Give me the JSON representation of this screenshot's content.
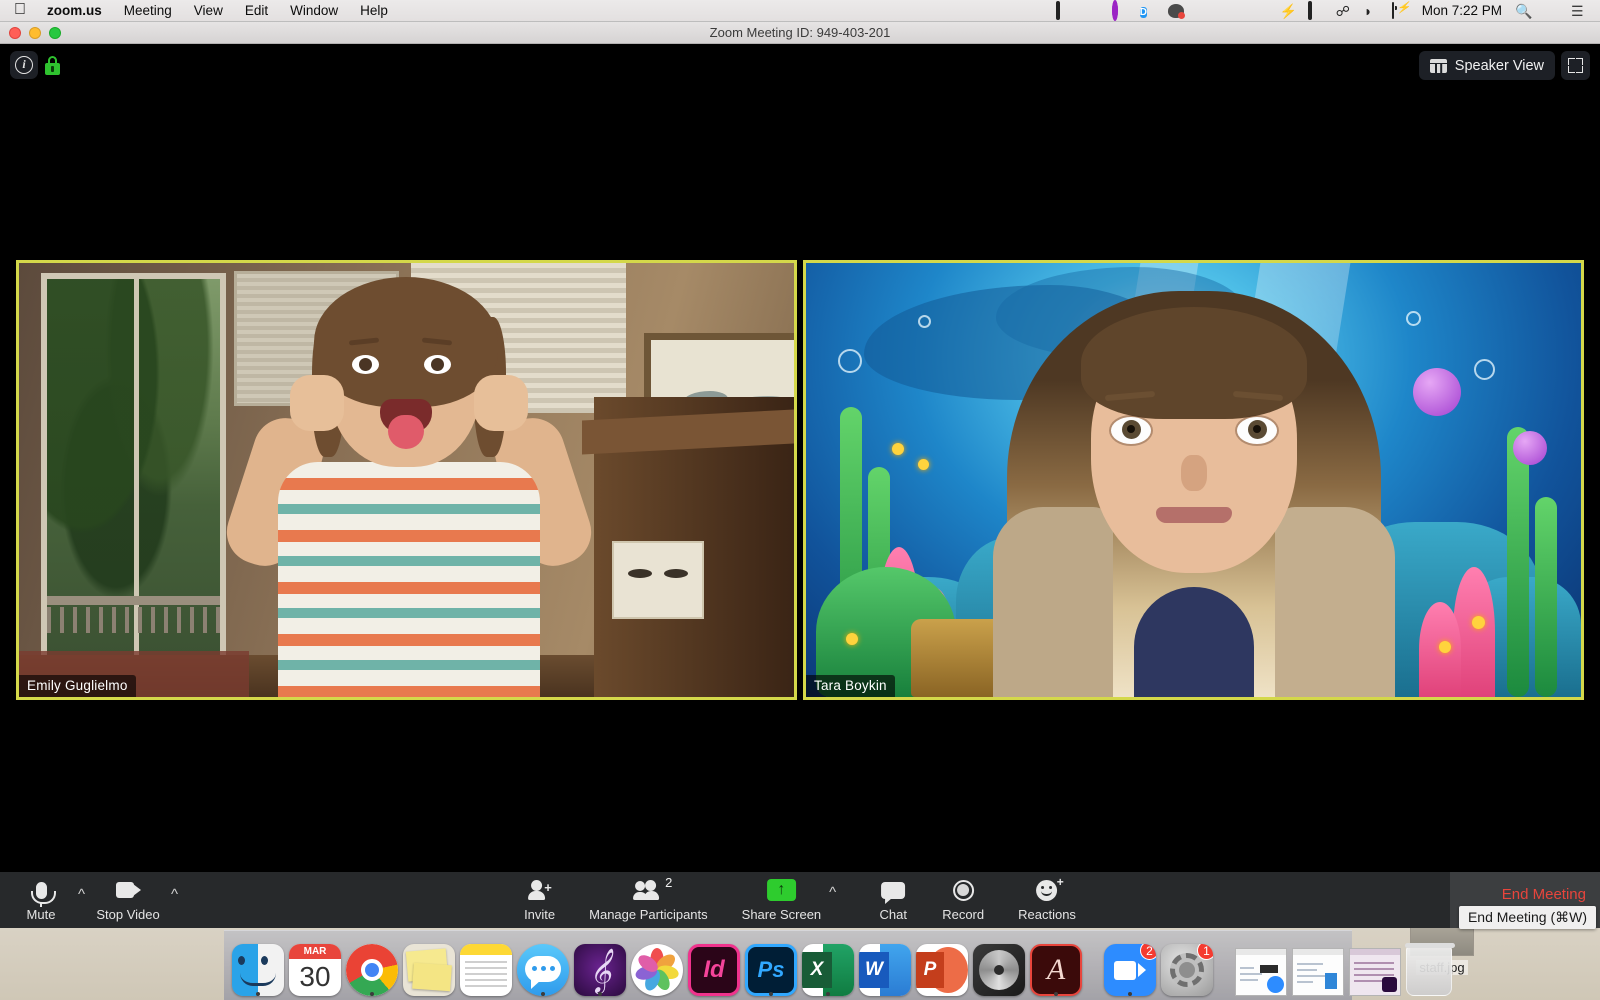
{
  "menubar": {
    "apple_icon": "apple-logo",
    "items": [
      {
        "label": "zoom.us",
        "bold": true
      },
      {
        "label": "Meeting"
      },
      {
        "label": "View"
      },
      {
        "label": "Edit"
      },
      {
        "label": "Window"
      },
      {
        "label": "Help"
      }
    ],
    "status_icons": [
      "screen-recording-icon",
      "location-services-icon",
      "circle-app-icon",
      "dropbox-icon",
      "app-icon",
      "green-orb-icon",
      "stacks-icon",
      "fastscripts-icon",
      "bolt-icon",
      "airplay-icon",
      "bluetooth-icon",
      "wifi-icon",
      "battery-charging-icon"
    ],
    "clock": "Mon 7:22 PM",
    "search_icon": "spotlight-search-icon",
    "siri_icon": "siri-icon",
    "notification_center_icon": "notification-center-icon"
  },
  "window": {
    "title": "Zoom Meeting ID: 949-403-201",
    "traffic_lights": [
      "close",
      "minimize",
      "zoom"
    ]
  },
  "stage": {
    "info_button": "i",
    "lock_icon": "encryption-lock-icon",
    "speaker_view_label": "Speaker View",
    "grid_icon": "speaker-view-icon",
    "fullscreen_icon": "enter-fullscreen-icon",
    "border_color": "#d4d84a"
  },
  "participants": [
    {
      "name": "Emily Guglielmo",
      "active_speaker": true
    },
    {
      "name": "Tara Boykin",
      "active_speaker": true
    }
  ],
  "controls": {
    "left": [
      {
        "name": "mute",
        "label": "Mute",
        "icon": "microphone-icon",
        "has_caret": true
      },
      {
        "name": "stop-video",
        "label": "Stop Video",
        "icon": "video-camera-icon",
        "has_caret": true
      }
    ],
    "center": [
      {
        "name": "invite",
        "label": "Invite",
        "icon": "person-add-icon",
        "badge": null
      },
      {
        "name": "manage-participants",
        "label": "Manage Participants",
        "icon": "people-icon",
        "badge": "2"
      },
      {
        "name": "share-screen",
        "label": "Share Screen",
        "icon": "share-screen-icon",
        "badge": null,
        "has_caret": true
      },
      {
        "name": "chat",
        "label": "Chat",
        "icon": "chat-bubble-icon",
        "badge": null
      },
      {
        "name": "record",
        "label": "Record",
        "icon": "record-circle-icon",
        "badge": null
      },
      {
        "name": "reactions",
        "label": "Reactions",
        "icon": "smiley-plus-icon",
        "badge": null
      }
    ],
    "end_meeting": {
      "label": "End Meeting",
      "color": "#e8453c",
      "tooltip": "End Meeting (⌘W)"
    }
  },
  "desktop": {
    "file_name": "staff.jpg"
  },
  "dock": {
    "items": [
      {
        "name": "finder",
        "icon": "finder-icon",
        "running": true,
        "badge": null
      },
      {
        "name": "calendar",
        "icon": "calendar-icon",
        "running": false,
        "badge": null,
        "month": "MAR",
        "day": "30"
      },
      {
        "name": "chrome",
        "icon": "google-chrome-icon",
        "running": true,
        "badge": null
      },
      {
        "name": "stickies",
        "icon": "stickies-icon",
        "running": false,
        "badge": null
      },
      {
        "name": "notes",
        "icon": "notes-icon",
        "running": false,
        "badge": null
      },
      {
        "name": "messages",
        "icon": "messages-icon",
        "running": true,
        "badge": null
      },
      {
        "name": "garageband",
        "icon": "garageband-icon",
        "running": true,
        "badge": null
      },
      {
        "name": "photos",
        "icon": "photos-icon",
        "running": false,
        "badge": null
      },
      {
        "name": "indesign",
        "icon": "adobe-indesign-icon",
        "running": false,
        "badge": null,
        "letters": "Id"
      },
      {
        "name": "photoshop",
        "icon": "adobe-photoshop-icon",
        "running": true,
        "badge": null,
        "letters": "Ps"
      },
      {
        "name": "excel",
        "icon": "microsoft-excel-icon",
        "running": true,
        "badge": null,
        "letters": "X"
      },
      {
        "name": "word",
        "icon": "microsoft-word-icon",
        "running": false,
        "badge": null,
        "letters": "W"
      },
      {
        "name": "powerpoint",
        "icon": "microsoft-powerpoint-icon",
        "running": false,
        "badge": null,
        "letters": "P"
      },
      {
        "name": "disk-utility",
        "icon": "disk-utility-icon",
        "running": false,
        "badge": null
      },
      {
        "name": "acrobat-reader",
        "icon": "adobe-acrobat-icon",
        "running": true,
        "badge": null
      },
      {
        "name": "zoom",
        "icon": "zoom-app-icon",
        "running": true,
        "badge": "2"
      },
      {
        "name": "system-preferences",
        "icon": "system-preferences-icon",
        "running": false,
        "badge": "1"
      },
      {
        "name": "minimized-window-1",
        "icon": "minimized-window-icon",
        "running": false,
        "badge": null
      },
      {
        "name": "minimized-window-2",
        "icon": "minimized-window-icon",
        "running": false,
        "badge": null
      },
      {
        "name": "minimized-window-3",
        "icon": "minimized-window-icon",
        "running": false,
        "badge": null
      },
      {
        "name": "trash",
        "icon": "trash-icon",
        "running": false,
        "badge": null
      }
    ]
  }
}
